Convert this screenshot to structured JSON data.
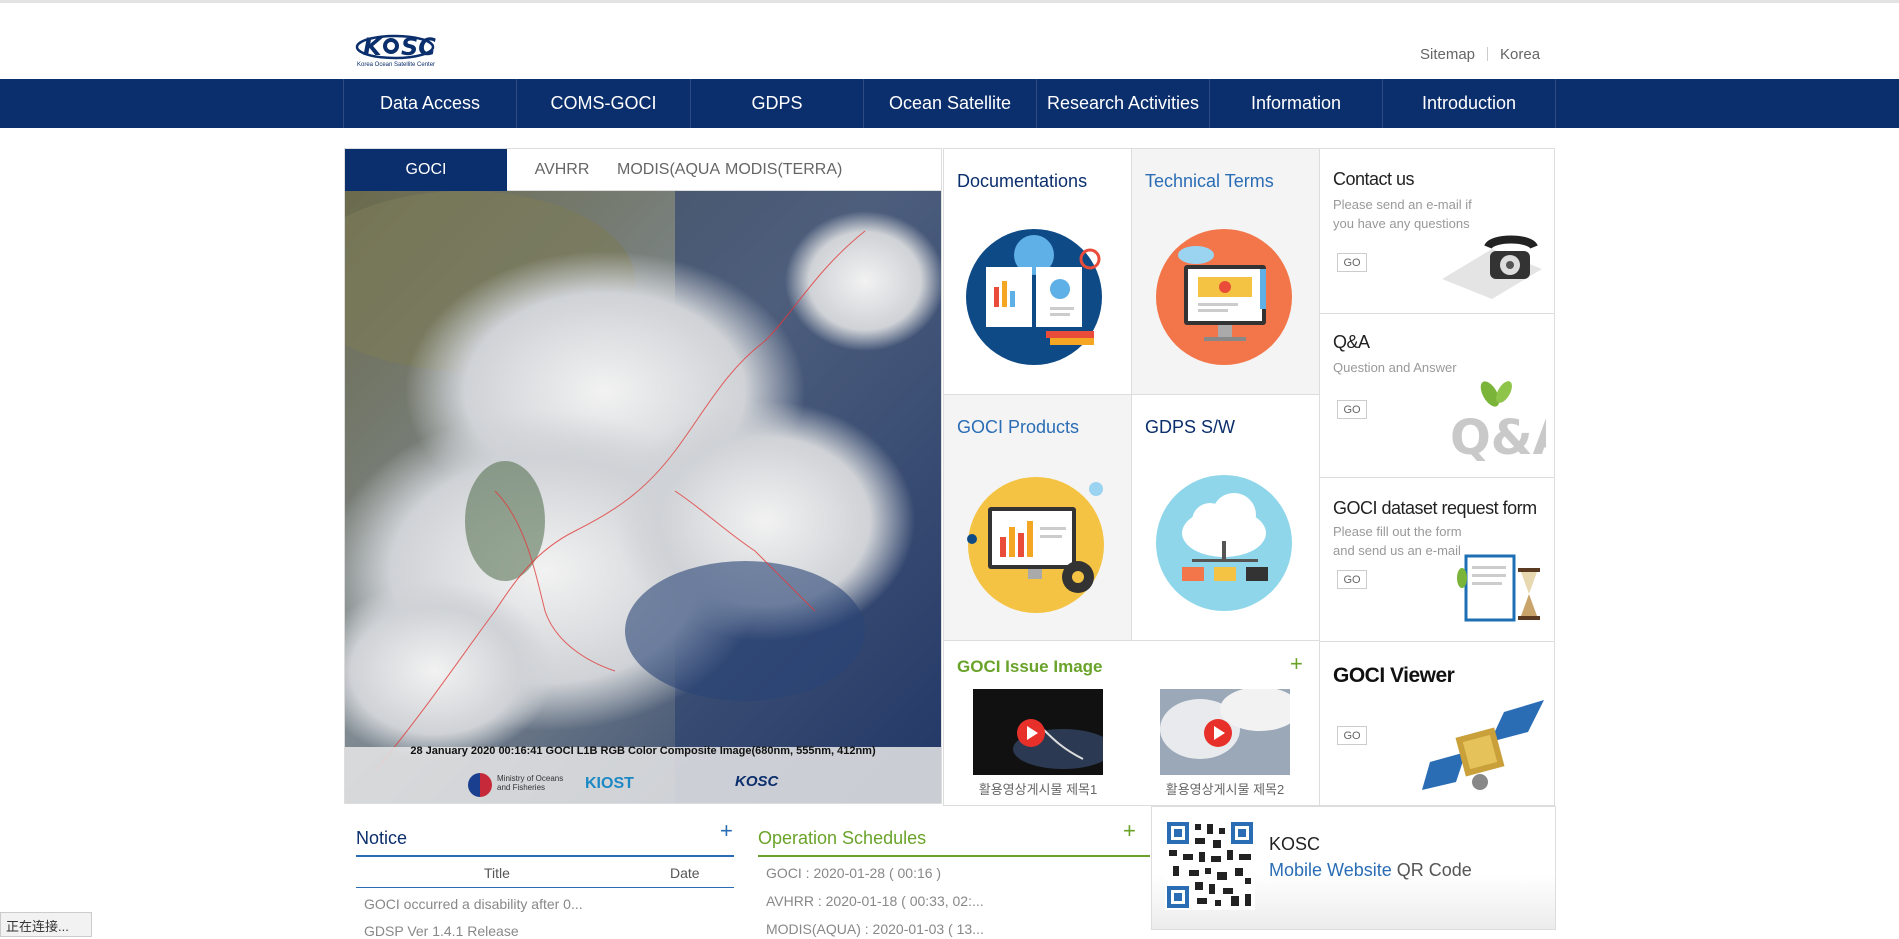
{
  "header": {
    "logo_text": "KOSC",
    "logo_sub": "Korea Ocean Satellite Center",
    "util_links": [
      "Sitemap",
      "Korea"
    ]
  },
  "nav": {
    "items": [
      "Data Access",
      "COMS-GOCI",
      "GDPS",
      "Ocean Satellite",
      "Research Activities",
      "Information",
      "Introduction"
    ]
  },
  "image_panel": {
    "tabs": [
      "GOCI",
      "AVHRR",
      "MODIS(AQUA",
      "MODIS(TERRA)"
    ],
    "active_tab": "GOCI",
    "caption": "28 January 2020 00:16:41 GOCI L1B RGB Color Composite Image(680nm, 555nm, 412nm)",
    "logos": [
      "Ministry of Oceans and Fisheries",
      "KIOST",
      "KOSC"
    ]
  },
  "tiles": {
    "documentations": "Documentations",
    "technical_terms": "Technical Terms",
    "goci_products": "GOCI Products",
    "gdps_sw": "GDPS S/W"
  },
  "issue_image": {
    "title": "GOCI Issue Image",
    "more": "+",
    "videos": [
      {
        "title": "활용영상게시물 제목1"
      },
      {
        "title": "활용영상게시물 제목2"
      }
    ]
  },
  "side": {
    "contact": {
      "title": "Contact us",
      "desc1": "Please send an e-mail if",
      "desc2": "you have any questions",
      "go": "GO"
    },
    "qna": {
      "title": "Q&A",
      "desc1": "Question and Answer",
      "go": "GO"
    },
    "dataset": {
      "title": "GOCI dataset request form",
      "desc1": "Please fill out the form",
      "desc2": "and send us an e-mail",
      "go": "GO"
    },
    "viewer": {
      "title": "GOCI Viewer",
      "go": "GO"
    }
  },
  "notice": {
    "title": "Notice",
    "more": "+",
    "col_title": "Title",
    "col_date": "Date",
    "rows": [
      "GOCI occurred a disability after 0...",
      "GDSP Ver 1.4.1 Release"
    ]
  },
  "schedules": {
    "title": "Operation Schedules",
    "more": "+",
    "rows": [
      "GOCI : 2020-01-28 ( 00:16 )",
      "AVHRR : 2020-01-18 ( 00:33, 02:...",
      "MODIS(AQUA) : 2020-01-03 ( 13..."
    ]
  },
  "qr": {
    "line1": "KOSC",
    "line2_blue": "Mobile Website",
    "line2_rest": " QR Code"
  },
  "statusbar": "正在连接..."
}
